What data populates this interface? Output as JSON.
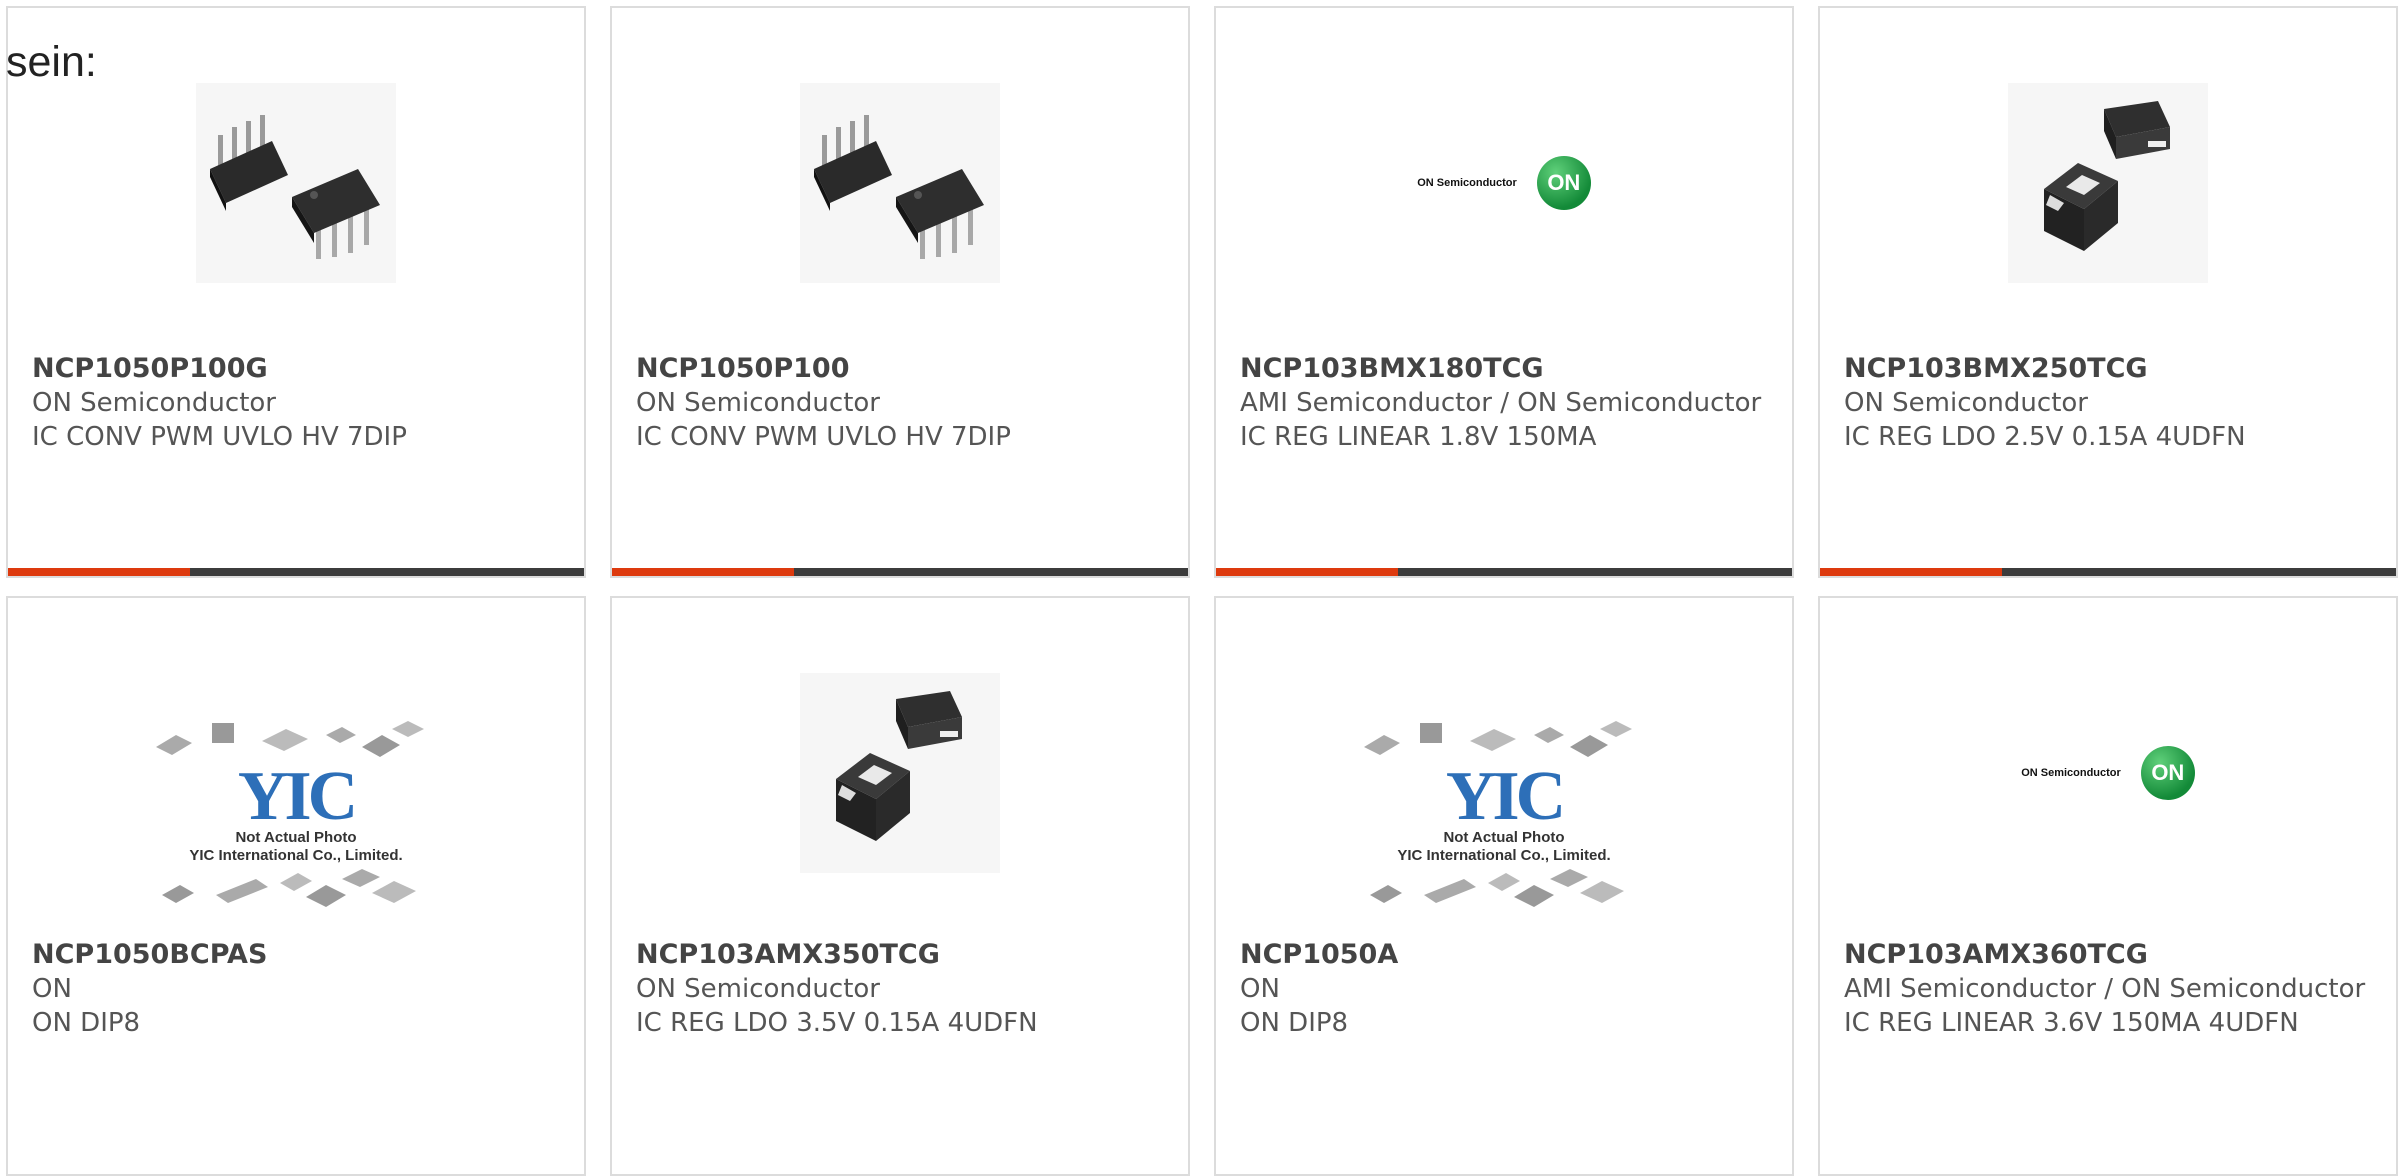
{
  "intro_text": "sein:",
  "images": {
    "on_logo_text": "ON Semiconductor",
    "on_circle_text": "ON",
    "yic_brand": "YIC",
    "yic_line1": "Not Actual Photo",
    "yic_line2": "YIC International Co., Limited."
  },
  "colors": {
    "accent_bar": "#dd3a0e",
    "bar_track": "#3c3c3c",
    "card_border": "#dcdcdc"
  },
  "products": [
    {
      "part": "NCP1050P100G",
      "manufacturer": "ON Semiconductor",
      "description": "IC CONV PWM UVLO HV 7DIP",
      "image": "dip7-package-icon"
    },
    {
      "part": "NCP1050P100",
      "manufacturer": "ON Semiconductor",
      "description": "IC CONV PWM UVLO HV 7DIP",
      "image": "dip7-package-icon"
    },
    {
      "part": "NCP103BMX180TCG",
      "manufacturer": "AMI Semiconductor / ON Semiconductor",
      "description": "IC REG LINEAR 1.8V 150MA",
      "image": "on-semiconductor-logo"
    },
    {
      "part": "NCP103BMX250TCG",
      "manufacturer": "ON Semiconductor",
      "description": "IC REG LDO 2.5V 0.15A 4UDFN",
      "image": "udfn-package-icon"
    },
    {
      "part": "NCP1050BCPAS",
      "manufacturer": "ON",
      "description": "ON DIP8",
      "image": "yic-placeholder"
    },
    {
      "part": "NCP103AMX350TCG",
      "manufacturer": "ON Semiconductor",
      "description": "IC REG LDO 3.5V 0.15A 4UDFN",
      "image": "udfn-package-icon"
    },
    {
      "part": "NCP1050A",
      "manufacturer": "ON",
      "description": "ON DIP8",
      "image": "yic-placeholder"
    },
    {
      "part": "NCP103AMX360TCG",
      "manufacturer": "AMI Semiconductor / ON Semiconductor",
      "description": "IC REG LINEAR 3.6V 150MA 4UDFN",
      "image": "on-semiconductor-logo"
    }
  ]
}
